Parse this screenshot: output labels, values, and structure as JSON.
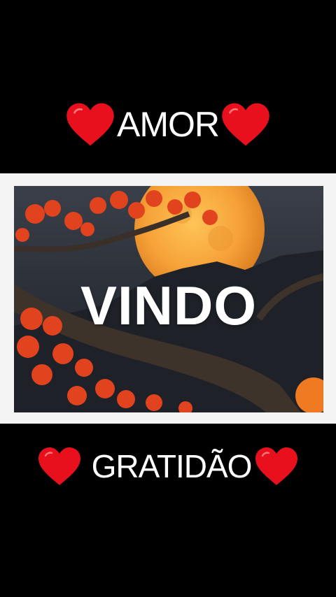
{
  "top_caption": {
    "word": "AMOR",
    "left_icon": "heart-icon",
    "right_icon": "heart-icon"
  },
  "image_caption": "VINDO",
  "bottom_caption": {
    "word": "GRATIDÃO",
    "left_icon": "heart-icon",
    "right_icon": "heart-icon"
  },
  "colors": {
    "background": "#000000",
    "heart": "#e8101c",
    "text": "#ffffff",
    "frame": "#f4f4f4"
  }
}
